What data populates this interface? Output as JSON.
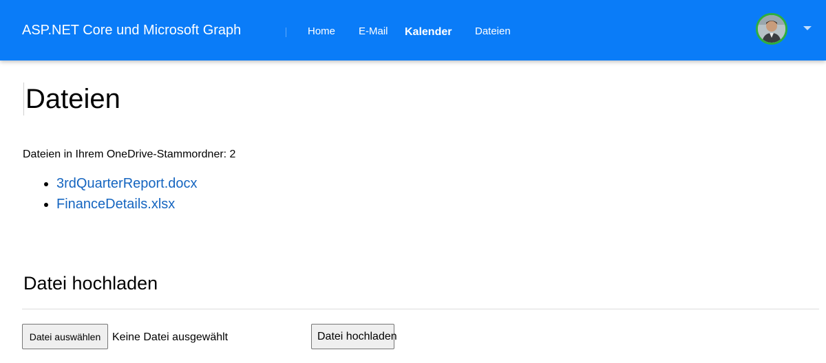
{
  "navbar": {
    "brand": "ASP.NET Core und Microsoft Graph",
    "items": [
      {
        "label": "Home"
      },
      {
        "label": "E-Mail"
      },
      {
        "label": "Kalender"
      },
      {
        "label": "Dateien"
      }
    ],
    "accent_color": "#0a7cf8",
    "avatar_border_color": "#2fae3e"
  },
  "main": {
    "title": "Dateien",
    "count_text": "Dateien in Ihrem OneDrive-Stammordner: 2",
    "files": [
      {
        "name": "3rdQuarterReport.docx"
      },
      {
        "name": "FinanceDetails.xlsx"
      }
    ],
    "link_color": "#1565c0"
  },
  "upload": {
    "title": "Datei hochladen",
    "choose_button_label": "Datei auswählen",
    "no_file_text": "Keine Datei ausgewählt",
    "upload_button_label": "Datei hochladen"
  }
}
